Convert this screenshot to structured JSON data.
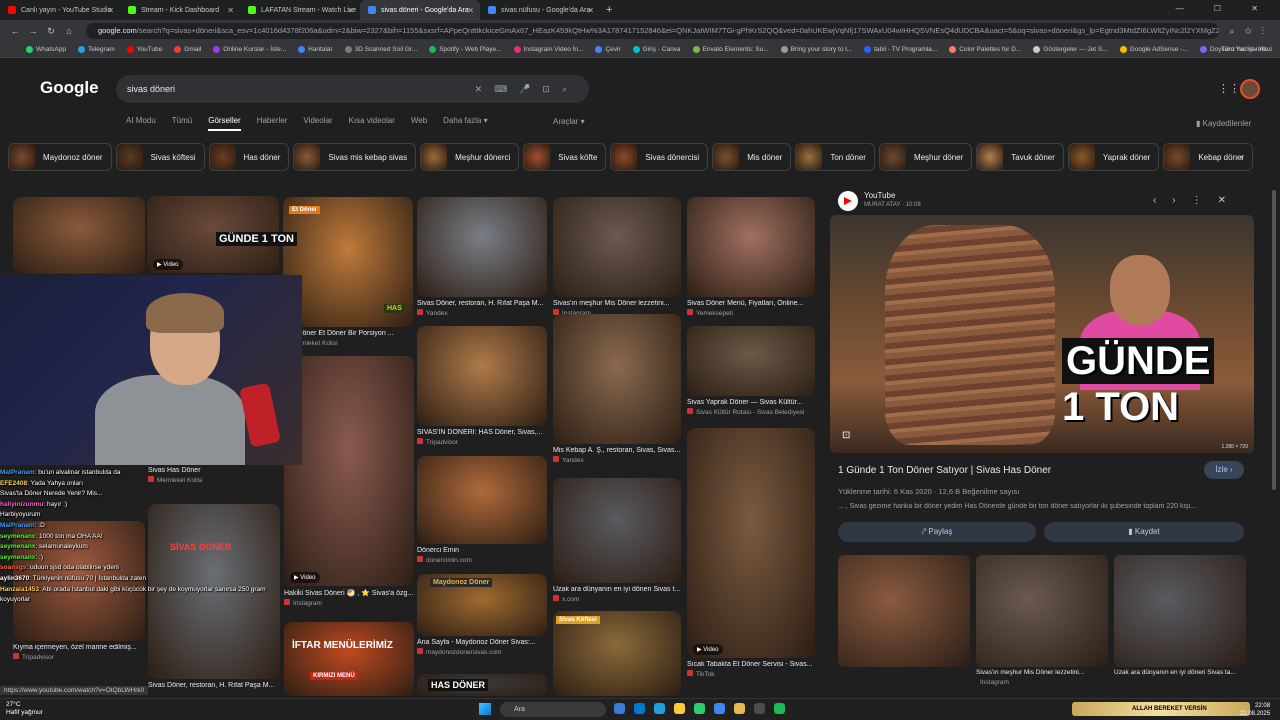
{
  "browser": {
    "tabs": [
      {
        "label": "Canlı yayın - YouTube Studio",
        "color": "#ff0000"
      },
      {
        "label": "Stream - Kick Dashboard",
        "color": "#53fc18"
      },
      {
        "label": "LAFATAN Stream - Watch Live",
        "color": "#53fc18"
      },
      {
        "label": "sivas döneri - Google'da Ara",
        "color": "#4285f4"
      },
      {
        "label": "sivas nüfusu - Google'da Ara",
        "color": "#4285f4"
      }
    ],
    "url_host": "google.com",
    "url_rest": "/search?q=sivas+döneri&sca_esv=1c4016d4378f206a&udm=2&biw=2327&bih=1155&sxsrf=APpeQntttkckiceGmAx67_HEazK459kQtHw%3A1787417152846&ei=QNKJatWIM7TGi-gPhKrS2QQ&ved=0ahUKEwjVqNfj17SWAxU04wIHHQSVNEsQ4dUDCBA&uact=5&oq=sivas+döneri&gs_lp=Egtnd3MtdZI6LWltZyINc2l2YXMgZ2",
    "bookmarks": [
      "WhatsApp",
      "Telegram",
      "YouTube",
      "Gmail",
      "Online Kurslar - İste...",
      "Haritalar",
      "3D Scanned Soil Gr...",
      "Spotify - Web Playe...",
      "Instagram Video İn...",
      "Çevir",
      "Giriş - Canva",
      "Envato Elements: Su...",
      "Bring your story to l...",
      "tabii - TV Programla...",
      "Color Palettes for D...",
      "Göstergeler — Jet S...",
      "Google AdSense -...",
      "Doysanz hazırl - Yo..."
    ],
    "bookmark_colors": [
      "#25d366",
      "#2aa1da",
      "#ff0000",
      "#ea4335",
      "#a435f0",
      "#4285f4",
      "#7a7a7a",
      "#1db954",
      "#e1306c",
      "#4285f4",
      "#00c4cc",
      "#82b541",
      "#999999",
      "#2962ff",
      "#ff7a59",
      "#cccccc",
      "#fbbc04",
      "#7b68ee"
    ],
    "all_bookmarks": "Tüm Yer İşaretleri",
    "status_url": "https://www.youtube.com/watch?v=OtQbLWHrk0"
  },
  "google": {
    "logo": "Google",
    "query": "sivas döneri",
    "filters": [
      "AI Modu",
      "Tümü",
      "Görseller",
      "Haberler",
      "Videolar",
      "Kısa videolar",
      "Web",
      "Daha fazla ▾"
    ],
    "active_filter": "Görseller",
    "tools": "Araçlar ▾",
    "saved": "Kaydedilenler",
    "chips": [
      {
        "label": "Maydonoz döner",
        "color": "#7a4a2e"
      },
      {
        "label": "Sivas köftesi",
        "color": "#5a3a22"
      },
      {
        "label": "Has döner",
        "color": "#6b3d24"
      },
      {
        "label": "Sivas mis kebap sivas",
        "color": "#8a5a3a"
      },
      {
        "label": "Meşhur dönerci",
        "color": "#9a6a3a"
      },
      {
        "label": "Sivas köfte",
        "color": "#a05030"
      },
      {
        "label": "Sivas dönercisi",
        "color": "#8a4a2a"
      },
      {
        "label": "Mis döner",
        "color": "#7a5030"
      },
      {
        "label": "Ton döner",
        "color": "#9a7040"
      },
      {
        "label": "Meşhur döner",
        "color": "#6a4a30"
      },
      {
        "label": "Tavuk döner",
        "color": "#b08050"
      },
      {
        "label": "Yaprak döner",
        "color": "#8a5a2a"
      },
      {
        "label": "Kebap döner",
        "color": "#7a4a2a"
      }
    ]
  },
  "results": [
    {
      "caption": "",
      "source": "",
      "tag": "",
      "color": "#8a5a3a"
    },
    {
      "caption": "",
      "source": "",
      "tag": "▶ Video",
      "color": "#6a4a3a"
    },
    {
      "caption": "Has Döner Et Döner Bir Porsiyon ...",
      "source": "Memleket Kolisi",
      "tag": "",
      "color": "#c07a3a"
    },
    {
      "caption": "Sivas Döner, restoran, H. Rıfat Paşa M...",
      "source": "Yandex",
      "tag": "",
      "color": "#7a7e86"
    },
    {
      "caption": "Sivas'ın meşhur Mis Döner lezzetini...",
      "source": "Instagram",
      "tag": "",
      "color": "#6a5a50"
    },
    {
      "caption": "Sivas Döner Menü, Fiyatları, Online...",
      "source": "Yemeksepeti",
      "tag": "",
      "color": "#a07060"
    },
    {
      "caption": "Sivas Has Döner",
      "source": "Memleket Kolisi",
      "tag": "",
      "color": "#9a6a4a"
    },
    {
      "caption": "Hakiki Sivas Döneri 🥙 ,  ⭐ Sivas'a özg...",
      "source": "Instagram",
      "tag": "▶ Video",
      "color": "#8a5a50"
    },
    {
      "caption": "SİVAS'IN DÖNERİ: HAS Döner, Sivas,...",
      "source": "Tripadvisor",
      "tag": "",
      "color": "#b07a4a"
    },
    {
      "caption": "Mis Kebap A. Ş., restoran, Sivas, Sivas...",
      "source": "Yandex",
      "tag": "",
      "color": "#8a6a50"
    },
    {
      "caption": "Sivas Yaprak Döner — Sivas Kültür...",
      "source": "Sivas Kültür Rotası - Sivas Belediyesi",
      "tag": "",
      "color": "#6a5a48"
    },
    {
      "caption": "Kıyma içermeyen, özel marine edilmiş...",
      "source": "Tripadvisor",
      "tag": "",
      "color": "#a05a40"
    },
    {
      "caption": "Sivas Döner, restoran, H. Rıfat Paşa M...",
      "source": "",
      "tag": "",
      "color": "#6a6e74"
    },
    {
      "caption": "Dönerci Emin",
      "source": "donercimin.com",
      "tag": "",
      "color": "#b06a3a"
    },
    {
      "caption": "Uzak ara dünyanın en iyi döneri Sivas t...",
      "source": "x.com",
      "tag": "",
      "color": "#5a5a60"
    },
    {
      "caption": "Sıcak Tabakta Et Döner Servisi - Sivas...",
      "source": "TikTok",
      "tag": "▶ Video",
      "color": "#7a5a40"
    },
    {
      "caption": "Ana Sayfa - Maydonoz Döner Sivas:...",
      "source": "maydonozdonersivas.com",
      "tag": "",
      "color": "#a06a30"
    },
    {
      "caption": "",
      "source": "",
      "tag": "",
      "color": "#c04a20"
    },
    {
      "caption": "",
      "source": "",
      "tag": "",
      "color": "#3a3a3a"
    },
    {
      "caption": "",
      "source": "",
      "tag": "",
      "color": "#8a6a3a"
    }
  ],
  "overlays": {
    "card2_text": "GÜNDE 1 TON",
    "menu_banner": "İFTAR MENÜLERİMİZ",
    "menu_banner_sub": "KIRMIZI MENÜ",
    "maydonoz_sign": "Maydonoz Döner",
    "hasdoner_sign": "HAS DÖNER",
    "sivas_doner_sign": "SİVAS DÖNER",
    "et_doner_badge": "Et Döner",
    "sivas_kofte_badge": "Sivas Köftesi",
    "has_logo": "HAS"
  },
  "chat": [
    {
      "name": "MalPranam",
      "text": ": bu'un alvalinar istanbulda da",
      "color": "#3aa0ff"
    },
    {
      "name": "EFE2408",
      "text": ": Yada Yahya onları",
      "color": "#ffd24a"
    },
    {
      "name": "",
      "text": "Sivas'ta Döner Nerede Yenir? Mis...",
      "color": "#fff"
    },
    {
      "name": "haliyinizunmu",
      "text": ": hayır :)",
      "color": "#ff5ac8"
    },
    {
      "name": "",
      "text": "Harbiyoyurum",
      "color": "#fff"
    },
    {
      "name": "MalPranam",
      "text": ": :D",
      "color": "#3aa0ff"
    },
    {
      "name": "seymenanx",
      "text": ": 1000 ton ma OHA AA!",
      "color": "#53fc18"
    },
    {
      "name": "seymenanx",
      "text": ": selamunaleykum",
      "color": "#53fc18"
    },
    {
      "name": "seymenanx",
      "text": ": :)",
      "color": "#53fc18"
    },
    {
      "name": "soansgs",
      "text": ": uduun sjsd oda olabilirse ydeni",
      "color": "#ff6a3a"
    },
    {
      "name": "aylin3670",
      "text": ": Türkiyenin nüfusu 70 | İstanbulda zaten",
      "color": "#fff"
    },
    {
      "name": "Hanzala1453",
      "text": ": Abi orada İstanbul daki gibi küçücük bir şey de koymuyorlar sanırsa 250 gram koyuyorlar",
      "color": "#ffd24a"
    }
  ],
  "panel": {
    "source": "YouTube",
    "author": "MURAT ATAY · 10:08",
    "overlay_l1": "GÜNDE",
    "overlay_l2": "1 TON",
    "dimensions": "1.280 × 720",
    "title": "1 Günde 1 Ton Döner Satıyor | Sivas Has Döner",
    "watch": "İzle ›",
    "meta": "Yüklenme tarihi: 6 Kas 2020  ·  12,6 B Beğenilme sayısı",
    "description": "... , Sivas gezime harika bir döner yedim Has Dönerde günde bir ton döner satıyorlar iki şubesinde toplam 220 kişi...",
    "share": "Paylaş",
    "save": "Kaydet",
    "related": [
      {
        "caption": "",
        "color": "#8a5a40"
      },
      {
        "caption": "Sivas'ın meşhur Mis Döner lezzetini...",
        "color": "#6a5a50"
      },
      {
        "caption": "Uzak ara dünyanın en iyi döneri Sivas ta...",
        "color": "#5a5a60"
      }
    ],
    "related_source": "Instagram"
  },
  "taskbar": {
    "temp": "27°C",
    "weather": "Hafif yağmur",
    "search": "Ara",
    "ticker": "ALLAH BEREKET VERSİN",
    "time": "22:08",
    "date": "22.08.2025",
    "app_colors": [
      "#3a7bd5",
      "#0078d4",
      "#1fa0e0",
      "#ffc83d",
      "#2ecc71",
      "#4285f4",
      "#e8b84a",
      "#4c4c4c",
      "#1db954"
    ]
  }
}
